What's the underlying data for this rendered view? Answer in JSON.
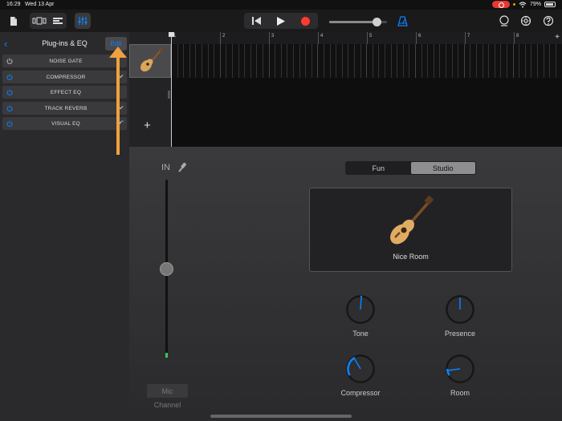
{
  "status_bar": {
    "time": "16:29",
    "date": "Wed 13 Apr",
    "battery": "79%"
  },
  "left_panel": {
    "title": "Plug-ins & EQ",
    "edit_label": "Edit",
    "plugins": [
      {
        "label": "NOISE GATE",
        "enabled": true
      },
      {
        "label": "COMPRESSOR",
        "enabled": true
      },
      {
        "label": "EFFECT EQ",
        "enabled": true
      },
      {
        "label": "TRACK REVERB",
        "enabled": true
      },
      {
        "label": "VISUAL EQ",
        "enabled": true
      }
    ]
  },
  "ruler": {
    "bars": [
      "1",
      "2",
      "3",
      "4",
      "5",
      "6",
      "7",
      "8"
    ]
  },
  "instrument": {
    "input_label": "IN",
    "mic_label": "Mic",
    "channel_label": "Channel",
    "modes": [
      "Fun",
      "Studio"
    ],
    "active_mode": "Studio",
    "preset": "Nice Room",
    "knobs": [
      {
        "label": "Tone"
      },
      {
        "label": "Presence"
      },
      {
        "label": "Compressor"
      },
      {
        "label": "Room"
      }
    ]
  },
  "colors": {
    "accent_blue": "#0a84ff",
    "record_red": "#ff3b30",
    "callout_orange": "#f0a040",
    "level_green": "#34c759"
  }
}
